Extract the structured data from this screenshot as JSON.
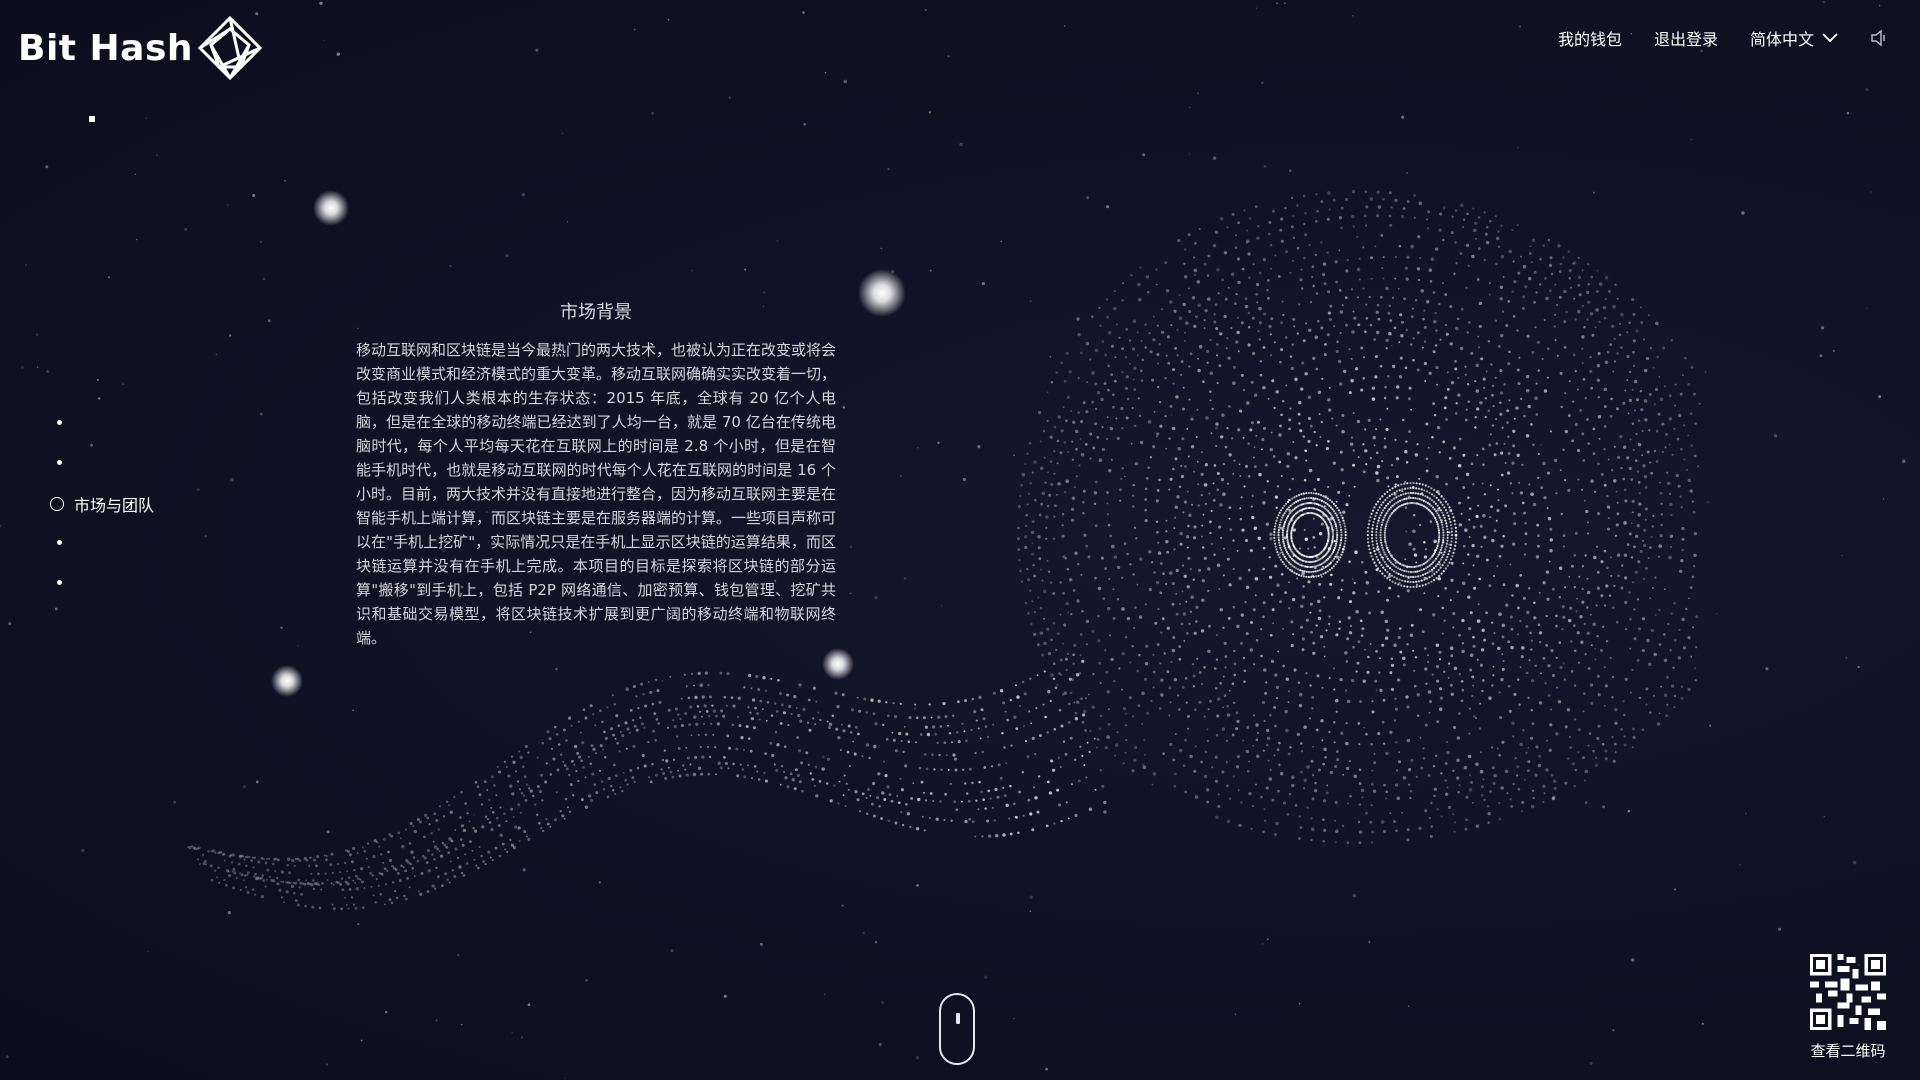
{
  "brand": {
    "name": "Bit Hash",
    "logo_icon": "diamond-lattice-icon"
  },
  "nav": {
    "wallet": "我的钱包",
    "logout": "退出登录",
    "language": "简体中文",
    "language_icon": "chevron-down-icon",
    "sound_icon": "speaker-icon"
  },
  "sections": [
    {
      "label": "",
      "active": false
    },
    {
      "label": "",
      "active": false
    },
    {
      "label": "市场与团队",
      "active": true
    },
    {
      "label": "",
      "active": false
    },
    {
      "label": "",
      "active": false
    }
  ],
  "article": {
    "title": "市场背景",
    "body": "移动互联网和区块链是当今最热门的两大技术，也被认为正在改变或将会改变商业模式和经济模式的重大变革。移动互联网确确实实改变着一切，包括改变我们人类根本的生存状态：2015 年底，全球有 20 亿个人电脑，但是在全球的移动终端已经达到了人均一台，就是 70 亿台在传统电脑时代，每个人平均每天花在互联网上的时间是 2.8 个小时，但是在智能手机时代，也就是移动互联网的时代每个人花在互联网的时间是 16 个小时。目前，两大技术并没有直接地进行整合，因为移动互联网主要是在智能手机上端计算，而区块链主要是在服务器端的计算。一些项目声称可以在\"手机上挖矿\"，实际情况只是在手机上显示区块链的运算结果，而区块链运算并没有在手机上完成。本项目的目标是探索将区块链的部分运算\"搬移\"到手机上，包括 P2P 网络通信、加密预算、钱包管理、挖矿共识和基础交易模型，将区块链技术扩展到更广阔的移动终端和物联网终端。"
  },
  "scroll_hint_icon": "mouse-scroll-icon",
  "qr": {
    "label": "查看二维码",
    "icon": "qr-code-icon"
  },
  "colors": {
    "background": "#0f1021",
    "text": "#ffffff",
    "particles": "#ffffff"
  }
}
